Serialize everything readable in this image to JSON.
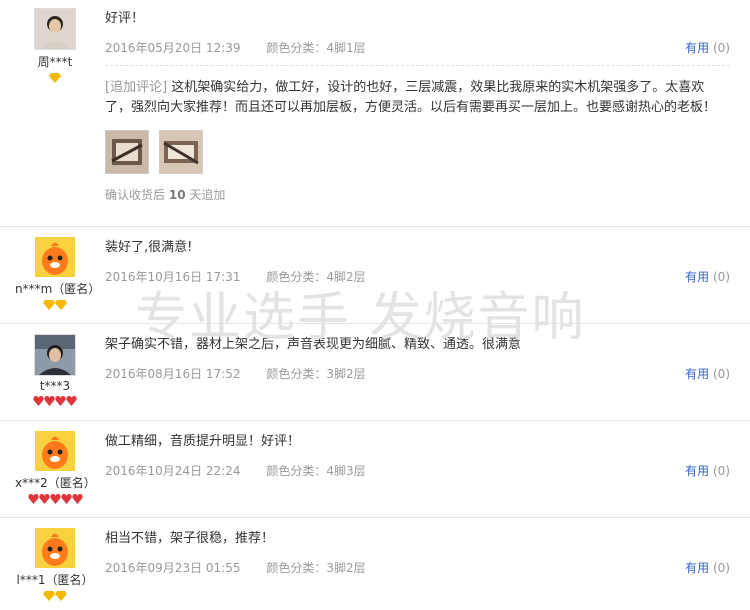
{
  "watermark": "专业选手 发烧音响",
  "reviews": [
    {
      "user": "周***t",
      "text": "好评！",
      "date": "2016年05月20日 12:39",
      "spec": "颜色分类：4脚1层",
      "useful_label": "有用",
      "useful_count": "(0)",
      "append_tag": "[追加评论]",
      "append_text": "这机架确实给力，做工好，设计的也好，三层减震，效果比我原来的实木机架强多了。太喜欢了，强烈向大家推荐！而且还可以再加层板，方便灵活。以后有需要再买一层加上。也要感谢热心的老板！",
      "follow_prefix": "确认收货后",
      "follow_days": "10",
      "follow_suffix": "天追加"
    },
    {
      "user": "n***m（匿名）",
      "text": "装好了,很满意!",
      "date": "2016年10月16日 17:31",
      "spec": "颜色分类：4脚2层",
      "useful_label": "有用",
      "useful_count": "(0)"
    },
    {
      "user": "t***3",
      "text": "架子确实不错，器材上架之后，声音表现更为细腻、精致、通透。很满意",
      "date": "2016年08月16日 17:52",
      "spec": "颜色分类：3脚2层",
      "useful_label": "有用",
      "useful_count": "(0)"
    },
    {
      "user": "x***2（匿名）",
      "text": "做工精细，音质提升明显！好评！",
      "date": "2016年10月24日 22:24",
      "spec": "颜色分类：4脚3层",
      "useful_label": "有用",
      "useful_count": "(0)"
    },
    {
      "user": "l***1（匿名）",
      "text": "相当不错，架子很稳，推荐！",
      "date": "2016年09月23日 01:55",
      "spec": "颜色分类：3脚2层",
      "useful_label": "有用",
      "useful_count": "(0)"
    }
  ],
  "colors": {
    "link": "#3366cc",
    "meta": "#999999",
    "badge_yellow": "#f5b800",
    "badge_red": "#e0353b"
  }
}
